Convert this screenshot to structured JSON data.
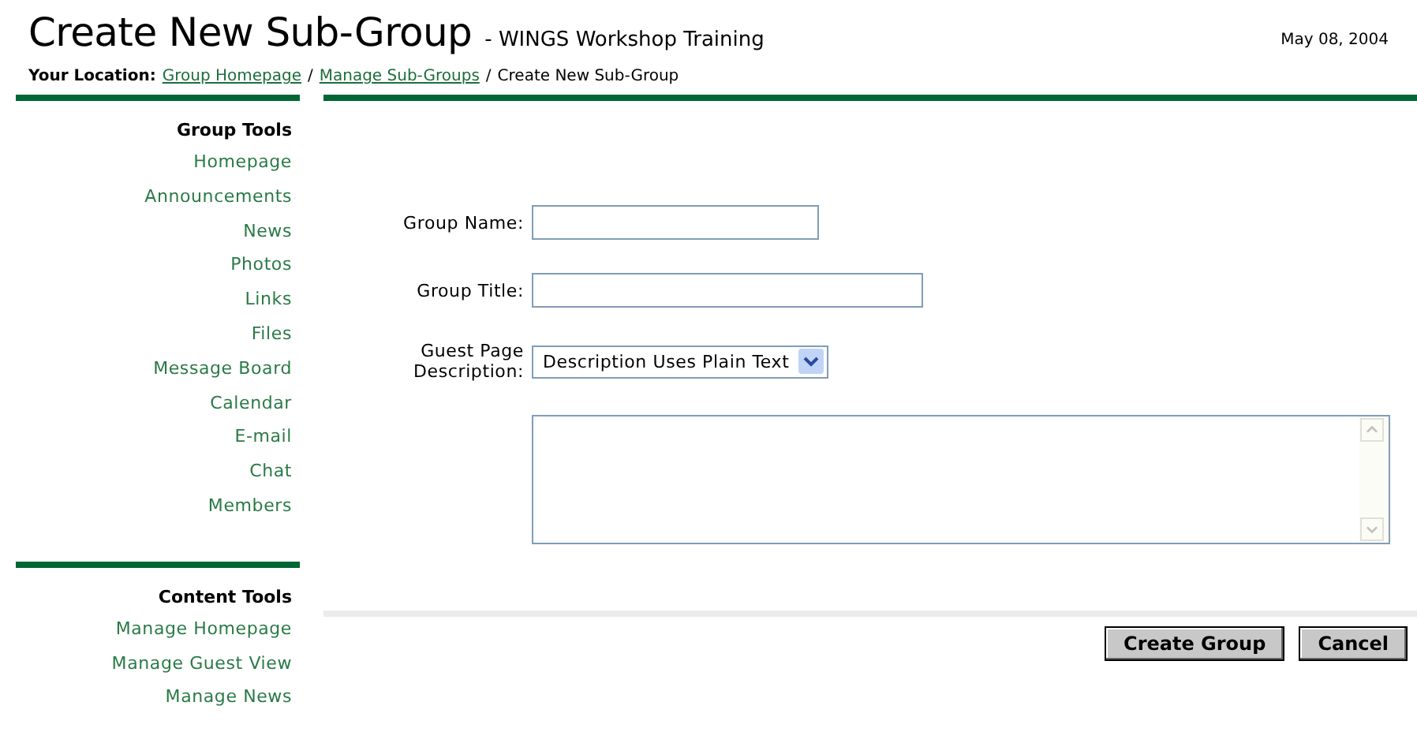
{
  "header": {
    "title": "Create New Sub-Group",
    "subtitle": "- WINGS Workshop Training",
    "date": "May 08, 2004"
  },
  "breadcrumb": {
    "label": "Your Location:",
    "links": [
      "Group Homepage",
      "Manage Sub-Groups"
    ],
    "separator": "/",
    "current": "Create New Sub-Group"
  },
  "sidebar": [
    {
      "heading": "Group Tools",
      "items": [
        "Homepage",
        "Announcements",
        "News",
        "Photos",
        "Links",
        "Files",
        "Message Board",
        "Calendar",
        "E-mail",
        "Chat",
        "Members"
      ]
    },
    {
      "heading": "Content Tools",
      "items": [
        "Manage Homepage",
        "Manage Guest View",
        "Manage News"
      ]
    }
  ],
  "form": {
    "fields": [
      {
        "kind": "short",
        "label": "Group Name:"
      },
      {
        "kind": "wide",
        "label": "Group Title:"
      },
      {
        "kind": "select",
        "label": "Guest Page Description:",
        "value": "Description Uses Plain Text"
      },
      {
        "kind": "textarea"
      }
    ],
    "buttons": [
      "Create Group",
      "Cancel"
    ]
  }
}
